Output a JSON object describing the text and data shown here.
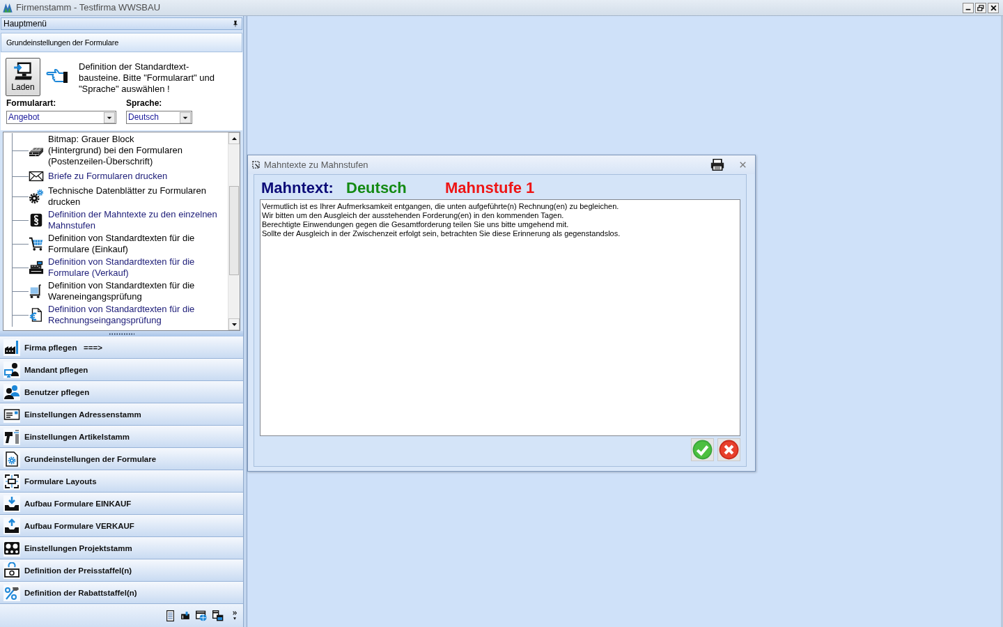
{
  "window": {
    "title": "Firmenstamm - Testfirma WWSBAU"
  },
  "main_menu": {
    "title": "Hauptmenü"
  },
  "section": {
    "title": "Grundeinstellungen der Formulare",
    "load_button": "Laden",
    "hint": "Definition der Standardtext-bausteine. Bitte \"Formularart\" und \"Sprache\" auswählen !",
    "fields": [
      {
        "label": "Formularart:",
        "value": "Angebot"
      },
      {
        "label": "Sprache:",
        "value": "Deutsch"
      }
    ]
  },
  "tree": {
    "items": [
      {
        "text": "Bitmap: Grauer Block\n(Hintergrund) bei den Formularen\n(Postenzeilen-Überschrift)",
        "color": "#000000"
      },
      {
        "text": "Briefe zu Formularen drucken",
        "color": "#20207a"
      },
      {
        "text": "Technische Datenblätter zu Formularen drucken",
        "color": "#000000"
      },
      {
        "text": "Definition der Mahntexte zu den einzelnen Mahnstufen",
        "color": "#20207a"
      },
      {
        "text": "Definition von Standardtexten für die Formulare (Einkauf)",
        "color": "#000000"
      },
      {
        "text": "Definition von Standardtexten für die Formulare (Verkauf)",
        "color": "#20207a"
      },
      {
        "text": "Definition von Standardtexten für die Wareneingangsprüfung",
        "color": "#000000"
      },
      {
        "text": "Definition von Standardtexten für die Rechnungseingangsprüfung",
        "color": "#20207a"
      }
    ]
  },
  "sidebar": {
    "items": [
      "Firma pflegen   ===>",
      "Mandant pflegen",
      "Benutzer pflegen",
      "Einstellungen Adressenstamm",
      "Einstellungen Artikelstamm",
      "Grundeinstellungen der Formulare",
      "Formulare Layouts",
      "Aufbau Formulare EINKAUF",
      "Aufbau Formulare VERKAUF",
      "Einstellungen Projektstamm",
      "Definition der Preisstaffel(n)",
      "Definition der Rabattstaffel(n)"
    ]
  },
  "dialog": {
    "title": "Mahntexte zu Mahnstufen",
    "heading": {
      "label": "Mahntext:",
      "language": "Deutsch",
      "stage": "Mahnstufe 1"
    },
    "text": "Vermutlich ist es Ihrer Aufmerksamkeit entgangen, die unten aufgeführte(n) Rechnung(en) zu begleichen.\nWir bitten um den Ausgleich der ausstehenden Forderung(en) in den kommenden Tagen.\nBerechtigte Einwendungen gegen die Gesamtforderung teilen Sie uns bitte umgehend mit.\nSollte der Ausgleich in der Zwischenzeit erfolgt sein, betrachten Sie diese Erinnerung als gegenstandslos."
  }
}
